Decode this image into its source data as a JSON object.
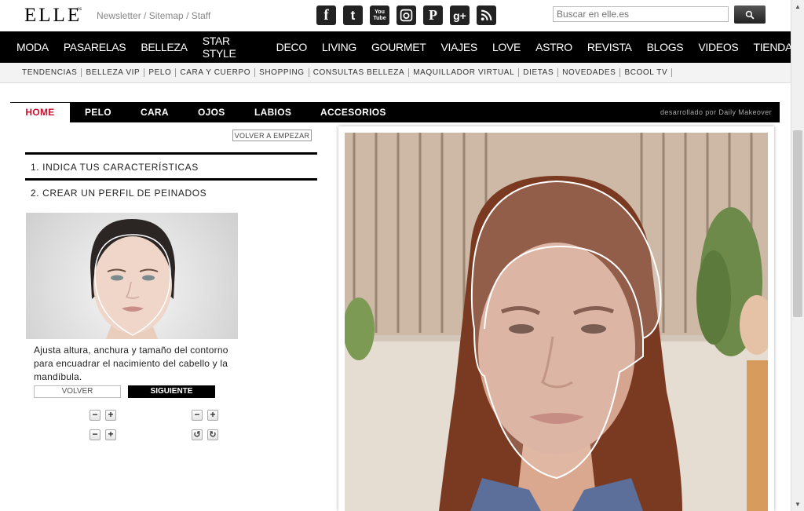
{
  "header": {
    "logo": "ELLE",
    "logo_sup": "es",
    "toplinks": [
      "Newsletter",
      "Sitemap",
      "Staff"
    ],
    "socials": [
      {
        "name": "facebook-icon",
        "glyph": "f"
      },
      {
        "name": "twitter-icon",
        "glyph": "t"
      },
      {
        "name": "youtube-icon",
        "glyph": "You Tube"
      },
      {
        "name": "instagram-icon",
        "glyph": ""
      },
      {
        "name": "pinterest-icon",
        "glyph": "P"
      },
      {
        "name": "google-plus-icon",
        "glyph": "g+"
      },
      {
        "name": "rss-icon",
        "glyph": ""
      }
    ],
    "search_placeholder": "Buscar en elle.es"
  },
  "main_nav": [
    "MODA",
    "PASARELAS",
    "BELLEZA",
    "STAR STYLE",
    "DECO",
    "LIVING",
    "GOURMET",
    "VIAJES",
    "LOVE",
    "ASTRO",
    "REVISTA",
    "BLOGS",
    "VIDEOS",
    "TIENDA"
  ],
  "sub_nav": [
    "TENDENCIAS",
    "BELLEZA VIP",
    "PELO",
    "CARA Y CUERPO",
    "SHOPPING",
    "CONSULTAS BELLEZA",
    "MAQUILLADOR VIRTUAL",
    "DIETAS",
    "NOVEDADES",
    "BCOOL TV"
  ],
  "app": {
    "tabs": [
      "HOME",
      "PELO",
      "CARA",
      "OJOS",
      "LABIOS",
      "ACCESORIOS"
    ],
    "credit": "desarrollado por Daily Makeover",
    "restart_label": "VOLVER A EMPEZAR",
    "step1": "1. INDICA TUS CARACTERÍSTICAS",
    "step2": "2. CREAR UN PERFIL DE PEINADOS",
    "instructions": "Ajusta altura, anchura y tamaño del contorno para encuadrar el nacimiento del cabello y la mandíbula.",
    "back_label": "VOLVER",
    "next_label": "SIGUIENTE",
    "controls": {
      "minus": "−",
      "plus": "+",
      "rotate_left": "↺",
      "rotate_right": "↻"
    }
  },
  "colors": {
    "accent": "#c8102e",
    "nav_bg": "#000000"
  }
}
